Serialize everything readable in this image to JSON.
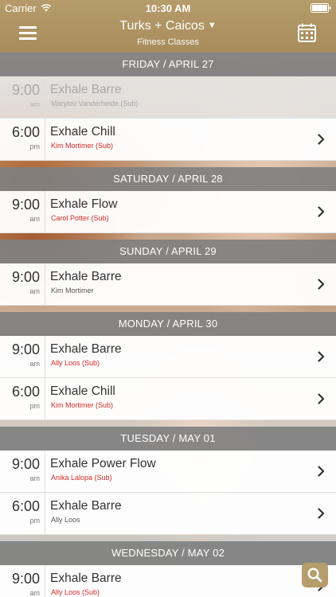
{
  "status": {
    "carrier": "Carrier",
    "time": "10:30 AM"
  },
  "header": {
    "location": "Turks + Caicos",
    "caret": "▼",
    "subtitle": "Fitness Classes"
  },
  "days": [
    {
      "label": "FRIDAY / APRIL 27",
      "classes": [
        {
          "time": "9:00",
          "ampm": "am",
          "name": "Exhale Barre",
          "instructor": "Marylou Vanderheide (Sub)",
          "sub": true,
          "past": true
        },
        {
          "time": "6:00",
          "ampm": "pm",
          "name": "Exhale Chill",
          "instructor": "Kim Mortimer (Sub)",
          "sub": true,
          "past": false
        }
      ]
    },
    {
      "label": "SATURDAY / APRIL 28",
      "classes": [
        {
          "time": "9:00",
          "ampm": "am",
          "name": "Exhale Flow",
          "instructor": "Carol Potter (Sub)",
          "sub": true,
          "past": false
        }
      ]
    },
    {
      "label": "SUNDAY / APRIL 29",
      "classes": [
        {
          "time": "9:00",
          "ampm": "am",
          "name": "Exhale Barre",
          "instructor": "Kim Mortimer",
          "sub": false,
          "past": false
        }
      ]
    },
    {
      "label": "MONDAY / APRIL 30",
      "classes": [
        {
          "time": "9:00",
          "ampm": "am",
          "name": "Exhale Barre",
          "instructor": "Ally Loos (Sub)",
          "sub": true,
          "past": false
        },
        {
          "time": "6:00",
          "ampm": "pm",
          "name": "Exhale Chill",
          "instructor": "Kim Mortimer (Sub)",
          "sub": true,
          "past": false
        }
      ]
    },
    {
      "label": "TUESDAY / MAY 01",
      "classes": [
        {
          "time": "9:00",
          "ampm": "am",
          "name": "Exhale Power Flow",
          "instructor": "Anika Lalopa (Sub)",
          "sub": true,
          "past": false
        },
        {
          "time": "6:00",
          "ampm": "pm",
          "name": "Exhale Barre",
          "instructor": "Ally Loos",
          "sub": false,
          "past": false
        }
      ]
    },
    {
      "label": "WEDNESDAY / MAY 02",
      "classes": [
        {
          "time": "9:00",
          "ampm": "am",
          "name": "Exhale Barre",
          "instructor": "Ally Loos (Sub)",
          "sub": true,
          "past": false
        }
      ]
    }
  ],
  "icons": {
    "menu": "hamburger-menu-icon",
    "calendar": "calendar-icon",
    "chevron": "chevron-right-icon",
    "search": "search-icon"
  },
  "colors": {
    "header": "#a88c5c",
    "day_header": "#808080",
    "sub_instructor": "#d22a2a",
    "search_button": "#b59d6c"
  }
}
